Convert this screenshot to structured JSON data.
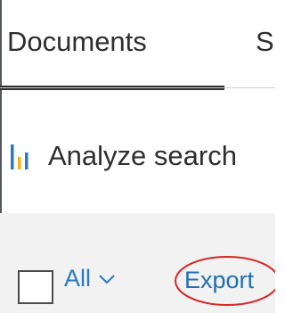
{
  "tabs": [
    {
      "label": "Documents",
      "active": true
    },
    {
      "label": "S",
      "active": false
    }
  ],
  "analyze": {
    "label": "Analyze search",
    "icon": "bar-chart-icon"
  },
  "toolbar": {
    "select_all_label": "All",
    "select_all_icon": "chevron-down-icon",
    "export_label": "Export"
  },
  "annotation": {
    "type": "circle-highlight",
    "target": "export",
    "color": "#d62828"
  },
  "colors": {
    "text": "#2e2e2e",
    "link": "#1e6fb9",
    "toolbar_bg": "#f2f2f2",
    "icon_blue": "#2a78c2",
    "icon_yellow": "#f2b21c"
  }
}
